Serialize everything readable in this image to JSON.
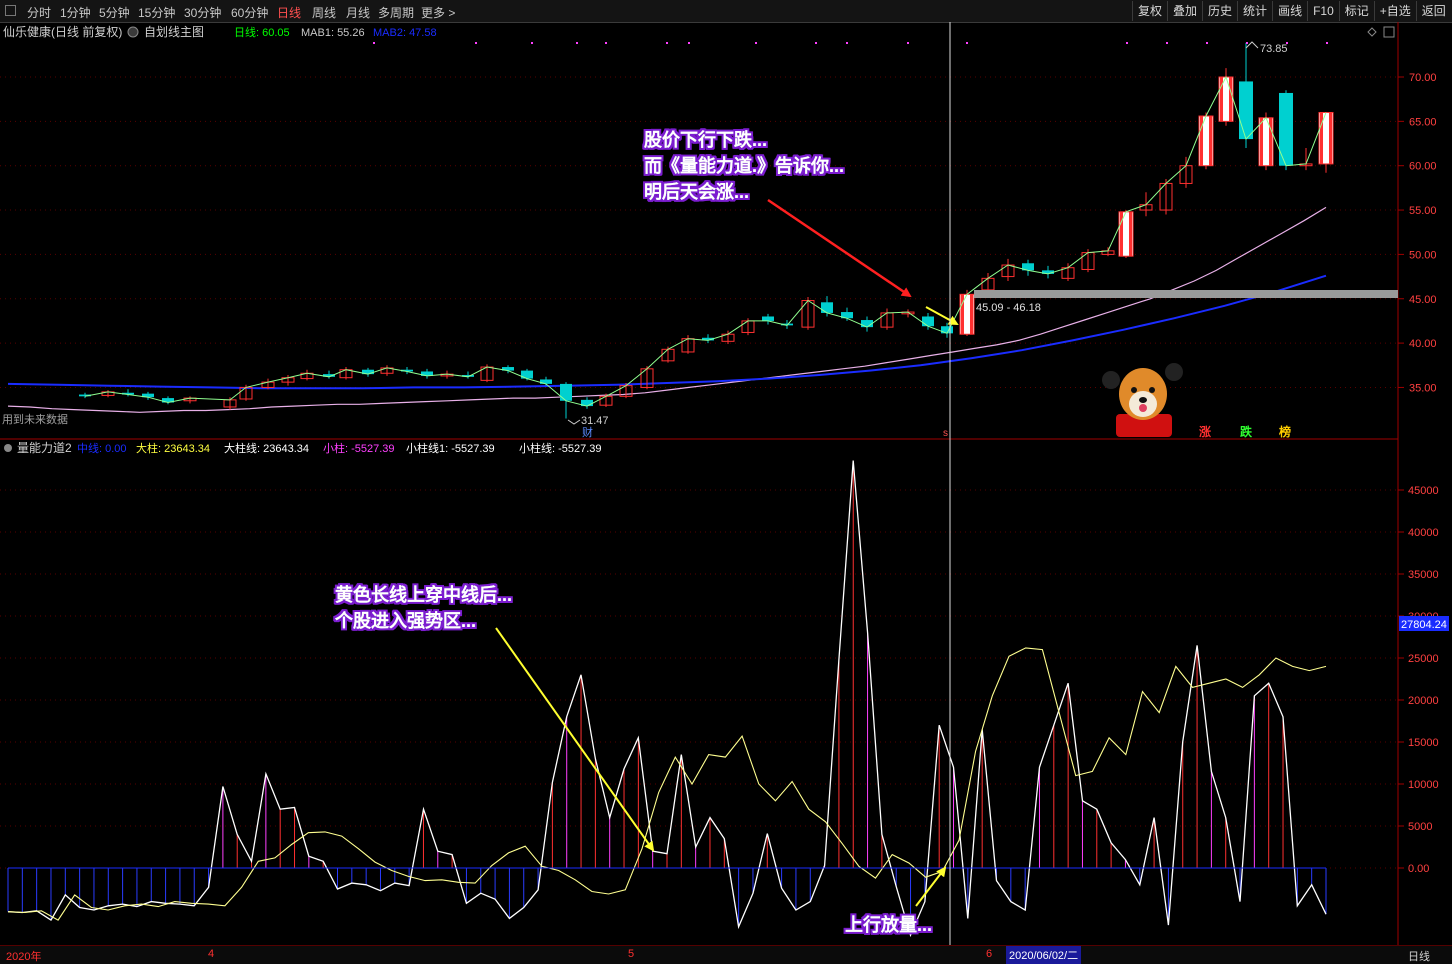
{
  "toolbar": {
    "periods": [
      "分时",
      "1分钟",
      "5分钟",
      "15分钟",
      "30分钟",
      "60分钟",
      "日线",
      "周线",
      "月线",
      "多周期",
      "更多 >"
    ],
    "active_period": "日线",
    "right_buttons": [
      "复权",
      "叠加",
      "历史",
      "统计",
      "画线",
      "F10",
      "标记",
      "+自选",
      "返回"
    ]
  },
  "colors": {
    "up": "#ff3030",
    "down": "#00d0d0",
    "ma_short": "#ffffff",
    "ma_long": "#1a2cff",
    "ma_mid": "#e8b0e8",
    "accent": "#ff4040",
    "callout_text": "#ffffff",
    "callout_glow": "#7b1fd0"
  },
  "main_chart": {
    "title": "仙乐健康(日线 前复权)",
    "sub_title": "自划线主图",
    "legend": [
      {
        "label": "日线: 60.05",
        "color": "#00ff00"
      },
      {
        "label": "MAB1: 55.26",
        "color": "#c8c8c8"
      },
      {
        "label": "MAB2: 47.58",
        "color": "#1a2cff"
      }
    ],
    "high_label": "73.85",
    "low_label": "31.47",
    "range_label": "45.09 - 46.18",
    "left_note": "用到未来数据",
    "marker_cai": "财",
    "marker_left": "s",
    "tags": [
      {
        "text": "涨",
        "color": "#ff3030"
      },
      {
        "text": "跌",
        "color": "#30ff30"
      },
      {
        "text": "榜",
        "color": "#ffcc00"
      }
    ],
    "price_ticks": [
      "70.00",
      "65.00",
      "60.00",
      "55.00",
      "50.00",
      "45.00",
      "40.00",
      "35.00"
    ],
    "callout_1": [
      "股价下行下跌...",
      "而《量能力道.》告诉你...",
      "明后天会涨..."
    ]
  },
  "indicator": {
    "title": "量能力道2",
    "items": [
      {
        "label": "中线: 0.00",
        "color": "#1a2cff"
      },
      {
        "label": "大柱: 23643.34",
        "color": "#ffff40"
      },
      {
        "label": "大柱线: 23643.34",
        "color": "#ffffff"
      },
      {
        "label": "小柱: -5527.39",
        "color": "#ff40ff"
      },
      {
        "label": "小柱线1: -5527.39",
        "color": "#ffffff"
      },
      {
        "label": "小柱线: -5527.39",
        "color": "#ffffff"
      }
    ],
    "cursor_value": "27804.24",
    "ticks": [
      "45000",
      "40000",
      "35000",
      "30000",
      "25000",
      "20000",
      "15000",
      "10000",
      "5000",
      "0.00"
    ],
    "callout_2": [
      "黄色长线上穿中线后...",
      "个股进入强势区..."
    ],
    "callout_3": "上行放量..."
  },
  "bottom": {
    "year": "2020年",
    "months": [
      "4",
      "5",
      "6"
    ],
    "cursor_date": "2020/06/02/二",
    "period": "日线"
  },
  "chart_data": [
    {
      "type": "candlestick",
      "title": "仙乐健康(日线 前复权)",
      "ylim": [
        31,
        75
      ],
      "ma_mid": [
        32.9,
        32.8,
        32.6,
        32.5,
        32.4,
        32.3,
        32.2,
        32.3,
        32.4,
        32.4,
        32.5,
        32.6,
        32.8,
        32.9,
        33.0,
        33.1,
        33.1,
        33.2,
        33.3,
        33.4,
        33.5,
        33.6,
        33.7,
        33.8,
        33.8,
        33.9,
        34.0,
        34.1,
        34.2,
        34.4,
        34.7,
        35.0,
        35.3,
        35.6,
        35.9,
        36.2,
        36.5,
        36.8,
        37.1,
        37.4,
        37.8,
        38.2,
        38.6,
        39.0,
        39.4,
        39.8,
        40.3,
        41.0,
        41.8,
        42.6,
        43.4,
        44.2,
        45.0,
        46.0,
        47.0,
        48.2,
        49.6,
        51.0,
        52.4,
        53.8,
        55.3
      ]
    },
    {
      "type": "bar",
      "title": "量能力道2",
      "ylim": [
        -9000,
        49000
      ],
      "xi": [
        0,
        3,
        7,
        12,
        17,
        21,
        26,
        31,
        36,
        41,
        46,
        50,
        55,
        60,
        64,
        69,
        74,
        79,
        83,
        88,
        93,
        97,
        102,
        107,
        112,
        116,
        121,
        126,
        131,
        136,
        140,
        145,
        150,
        155,
        159,
        164,
        169,
        174,
        178,
        183,
        188,
        193,
        198,
        202,
        207,
        212,
        217,
        221,
        226,
        231,
        236,
        241,
        245,
        250,
        255,
        260,
        264,
        269,
        274,
        279,
        284,
        288,
        293,
        298,
        303,
        307,
        312,
        318
      ],
      "small": [
        -5200,
        -5300,
        -5100,
        -6200,
        -3200,
        -4700,
        -5000,
        -4500,
        -4300,
        -4600,
        -4000,
        -4200,
        -4300,
        -4500,
        -2300,
        9700,
        4000,
        800,
        11200,
        7000,
        7200,
        1400,
        800,
        -2500,
        -1800,
        -2000,
        -2700,
        -1800,
        -2100,
        7000,
        2000,
        1600,
        -4200,
        -3000,
        -3700,
        -6000,
        -4700,
        -2600,
        10200,
        18000,
        23000,
        13000,
        6000,
        11800,
        15500,
        2000,
        1700,
        13500,
        2500,
        6000,
        3500,
        -7000,
        -3000,
        4100,
        -2400,
        -5000,
        -4000,
        300,
        24800,
        48500,
        28000,
        4000,
        -2200,
        -8000,
        -4000,
        17000,
        12000,
        -6000,
        16500,
        -1500,
        -4000,
        -5000,
        12000,
        17000,
        22000,
        8000,
        7000,
        3000,
        1000,
        -2000,
        6000,
        -6800,
        15000,
        26500,
        11500,
        6000,
        -4000,
        20500,
        22000,
        18000,
        -4500,
        -2000,
        -5500
      ],
      "big_line": [
        -5200,
        -5300,
        -5100,
        -6200,
        -3200,
        -4700,
        -5000,
        -4500,
        -4300,
        -4600,
        -4000,
        -4200,
        -4300,
        -4500,
        -2300,
        800,
        1200,
        2800,
        4200,
        4300,
        3800,
        2300,
        700,
        -300,
        -1000,
        -1500,
        -1400,
        -1700,
        -1800,
        300,
        1800,
        2600,
        200,
        -300,
        -1400,
        -2800,
        -3100,
        -2600,
        2300,
        9000,
        13200,
        10000,
        13500,
        13200,
        15700,
        10000,
        8000,
        10300,
        7000,
        5500,
        2900,
        200,
        -1200,
        1600,
        600,
        -1100,
        -400,
        3300,
        13900,
        20500,
        25200,
        26200,
        26000,
        18500,
        11000,
        11500,
        15500,
        13500,
        21000,
        18500,
        24000,
        21500,
        22000,
        22500,
        21500,
        23000,
        25000,
        24000,
        23500,
        24000
      ]
    }
  ]
}
